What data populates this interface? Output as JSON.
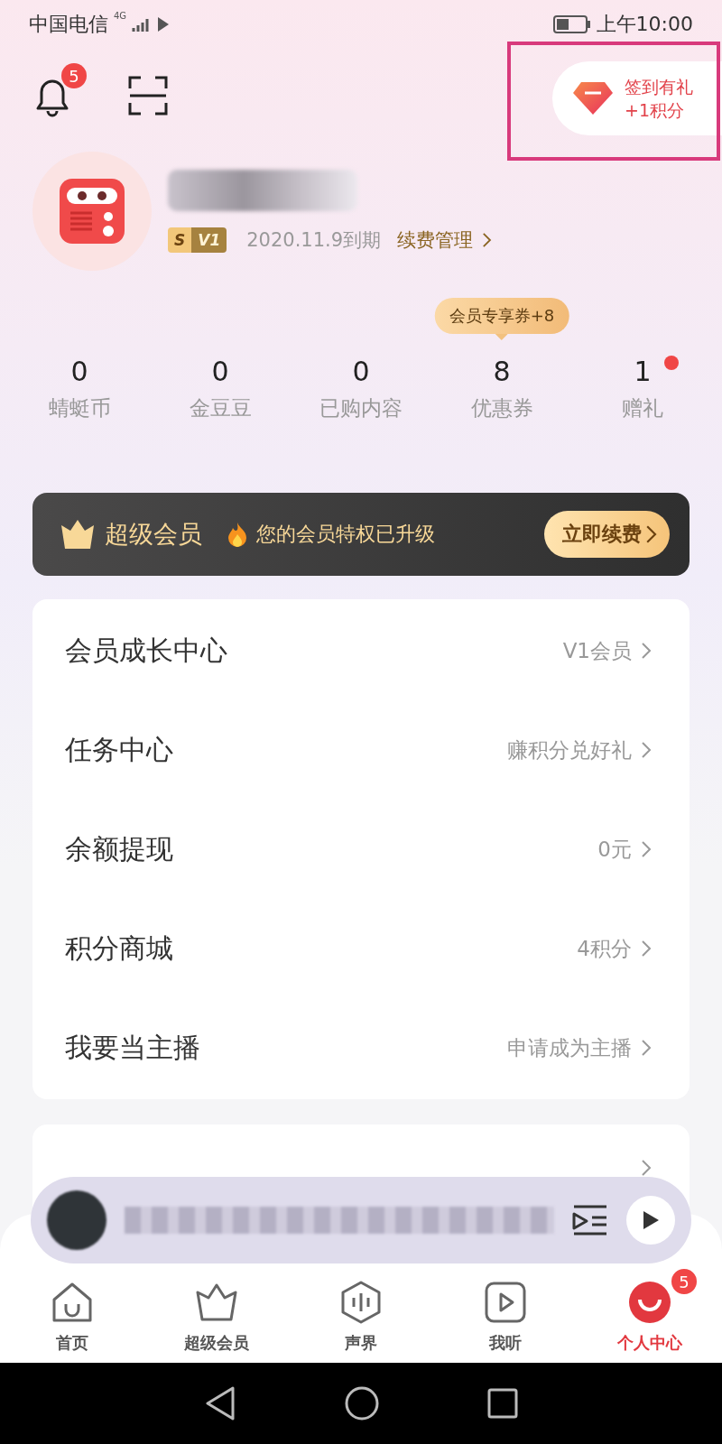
{
  "status_bar": {
    "carrier": "中国电信",
    "network": "4G",
    "time": "上午10:00"
  },
  "header": {
    "notification_badge": "5",
    "checkin": {
      "title": "签到有礼",
      "subtitle": "+1积分"
    }
  },
  "profile": {
    "badge_letter": "S",
    "level": "V1",
    "expiry": "2020.11.9到期",
    "renew_link": "续费管理"
  },
  "stats": [
    {
      "value": "0",
      "label": "蜻蜓币",
      "dot": false
    },
    {
      "value": "0",
      "label": "金豆豆",
      "dot": false
    },
    {
      "value": "0",
      "label": "已购内容",
      "dot": false
    },
    {
      "value": "8",
      "label": "优惠券",
      "dot": false,
      "tooltip": "会员专享券+8"
    },
    {
      "value": "1",
      "label": "赠礼",
      "dot": true
    }
  ],
  "banner": {
    "title": "超级会员",
    "message": "您的会员特权已升级",
    "button": "立即续费"
  },
  "menu": [
    {
      "label": "会员成长中心",
      "value": "V1会员"
    },
    {
      "label": "任务中心",
      "value": "赚积分兑好礼"
    },
    {
      "label": "余额提现",
      "value": "0元"
    },
    {
      "label": "积分商城",
      "value": "4积分"
    },
    {
      "label": "我要当主播",
      "value": "申请成为主播"
    }
  ],
  "tab_bar": [
    {
      "kind": "home",
      "label": "首页",
      "selected": false
    },
    {
      "kind": "vip",
      "label": "超级会员",
      "selected": false
    },
    {
      "kind": "sound",
      "label": "声界",
      "selected": false
    },
    {
      "kind": "listen",
      "label": "我听",
      "selected": false
    },
    {
      "kind": "me",
      "label": "个人中心",
      "selected": true,
      "badge": "5"
    }
  ]
}
